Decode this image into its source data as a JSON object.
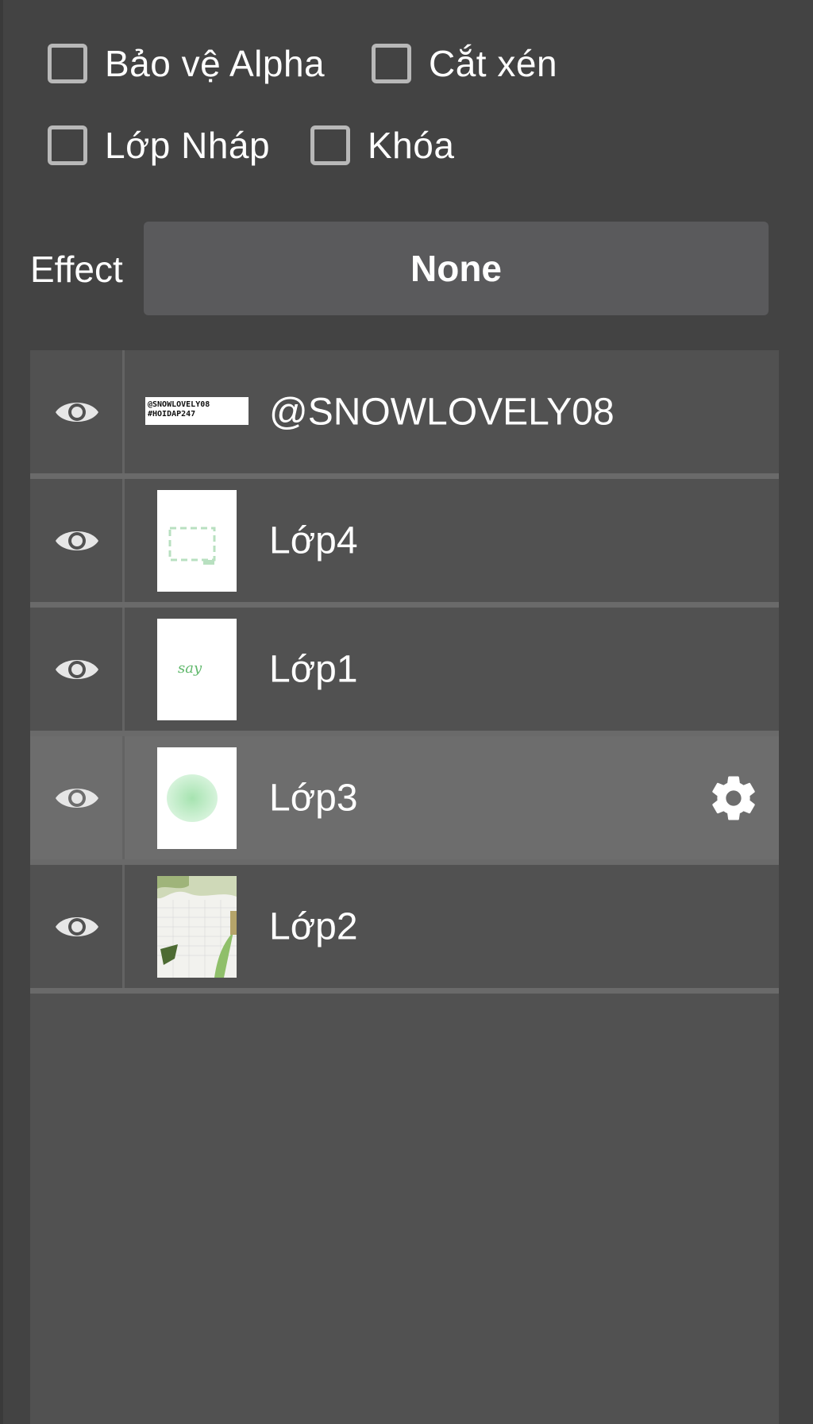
{
  "options": {
    "alpha_protect": "Bảo vệ Alpha",
    "clipping": "Cắt xén",
    "draft_layer": "Lớp Nháp",
    "lock": "Khóa"
  },
  "effect": {
    "label": "Effect",
    "value": "None"
  },
  "layers": [
    {
      "name": "@SNOWLOVELY08",
      "visible": true,
      "thumb_text_line1": "@SNOWLOVELY08",
      "thumb_text_line2": "#HOIDAP247"
    },
    {
      "name": "Lớp4",
      "visible": true
    },
    {
      "name": "Lớp1",
      "visible": true,
      "thumb_text": "say"
    },
    {
      "name": "Lớp3",
      "visible": true,
      "selected": true
    },
    {
      "name": "Lớp2",
      "visible": true
    }
  ],
  "icons": {
    "eye": "eye-icon",
    "gear": "gear-icon"
  },
  "colors": {
    "background": "#434343",
    "panel": "#515151",
    "selected_row": "#6d6d6d",
    "effect_button": "#5a5a5c",
    "checkbox_border": "#b8b8b8",
    "thumb_green": "#8fd49a"
  }
}
